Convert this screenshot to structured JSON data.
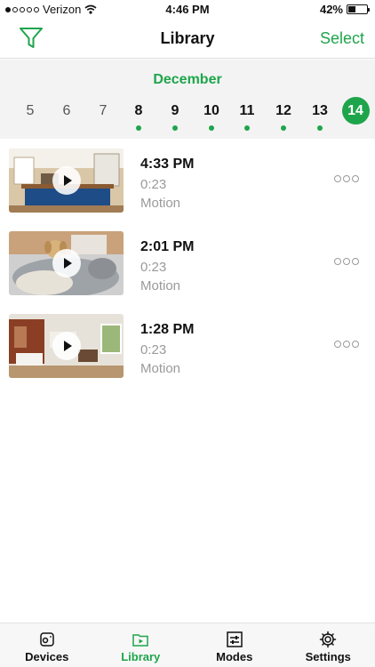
{
  "status_bar": {
    "carrier": "Verizon",
    "time": "4:46 PM",
    "battery": "42%",
    "battery_level": 0.42
  },
  "nav": {
    "title": "Library",
    "select_label": "Select",
    "filter_icon": "funnel-icon"
  },
  "calendar": {
    "month": "December",
    "days": [
      {
        "label": "5",
        "has_events": false,
        "selected": false
      },
      {
        "label": "6",
        "has_events": false,
        "selected": false
      },
      {
        "label": "7",
        "has_events": false,
        "selected": false
      },
      {
        "label": "8",
        "has_events": true,
        "selected": false
      },
      {
        "label": "9",
        "has_events": true,
        "selected": false
      },
      {
        "label": "10",
        "has_events": true,
        "selected": false
      },
      {
        "label": "11",
        "has_events": true,
        "selected": false
      },
      {
        "label": "12",
        "has_events": true,
        "selected": false
      },
      {
        "label": "13",
        "has_events": true,
        "selected": false
      },
      {
        "label": "14",
        "has_events": false,
        "selected": true
      }
    ]
  },
  "clips": [
    {
      "time": "4:33 PM",
      "duration": "0:23",
      "type": "Motion",
      "scene": "kitchen"
    },
    {
      "time": "2:01 PM",
      "duration": "0:23",
      "type": "Motion",
      "scene": "dog-on-couch"
    },
    {
      "time": "1:28 PM",
      "duration": "0:23",
      "type": "Motion",
      "scene": "living-room"
    }
  ],
  "tabs": [
    {
      "label": "Devices",
      "icon": "camera-device-icon",
      "active": false
    },
    {
      "label": "Library",
      "icon": "video-library-icon",
      "active": true
    },
    {
      "label": "Modes",
      "icon": "sliders-icon",
      "active": false
    },
    {
      "label": "Settings",
      "icon": "gear-icon",
      "active": false
    }
  ],
  "colors": {
    "accent": "#1ea54b",
    "muted_text": "#9a9a9a",
    "strip_background": "#f3f3f3"
  }
}
